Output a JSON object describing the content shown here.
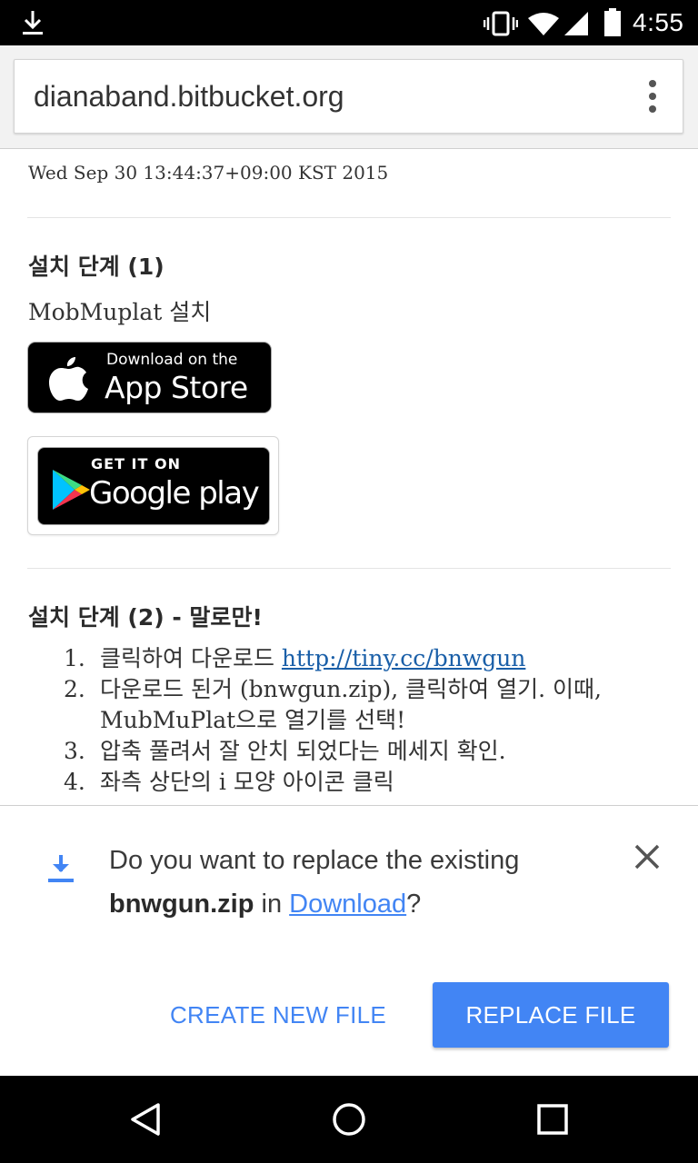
{
  "status_bar": {
    "time": "4:55",
    "icons": [
      "download-icon",
      "vibrate-icon",
      "wifi-icon",
      "signal-icon",
      "battery-icon"
    ]
  },
  "browser": {
    "url": "dianaband.bitbucket.org",
    "menu_icon": "overflow-menu-icon"
  },
  "page": {
    "date": "Wed Sep 30 13:44:37+09:00 KST 2015",
    "step1": {
      "heading": "설치 단계 (1)",
      "text": "MobMuplat 설치",
      "appstore": {
        "small": "Download on the",
        "big": "App Store"
      },
      "gplay": {
        "small": "GET IT ON",
        "big": "Google play"
      }
    },
    "step2": {
      "heading": "설치 단계 (2) - 말로만!",
      "items": [
        {
          "num": "1.",
          "text": "클릭하여 다운로드 ",
          "link": "http://tiny.cc/bnwgun"
        },
        {
          "num": "2.",
          "text": "다운로드 된거 (bnwgun.zip), 클릭하여 열기. 이때, MubMuPlat으로 열기를 선택!"
        },
        {
          "num": "3.",
          "text": "압축 풀려서 잘 안치 되었다는 메세지 확인."
        },
        {
          "num": "4.",
          "text": "좌측 상단의 i 모양 아이콘 클릭"
        }
      ]
    }
  },
  "download_prompt": {
    "message_prefix": "Do you want to replace the existing ",
    "filename": "bnwgun.zip",
    "in": " in ",
    "folder": "Download",
    "suffix": "?",
    "create_label": "CREATE NEW FILE",
    "replace_label": "REPLACE FILE",
    "accent_color": "#4285f4"
  },
  "nav_bar": {
    "icons": [
      "back-icon",
      "home-icon",
      "recents-icon"
    ]
  }
}
